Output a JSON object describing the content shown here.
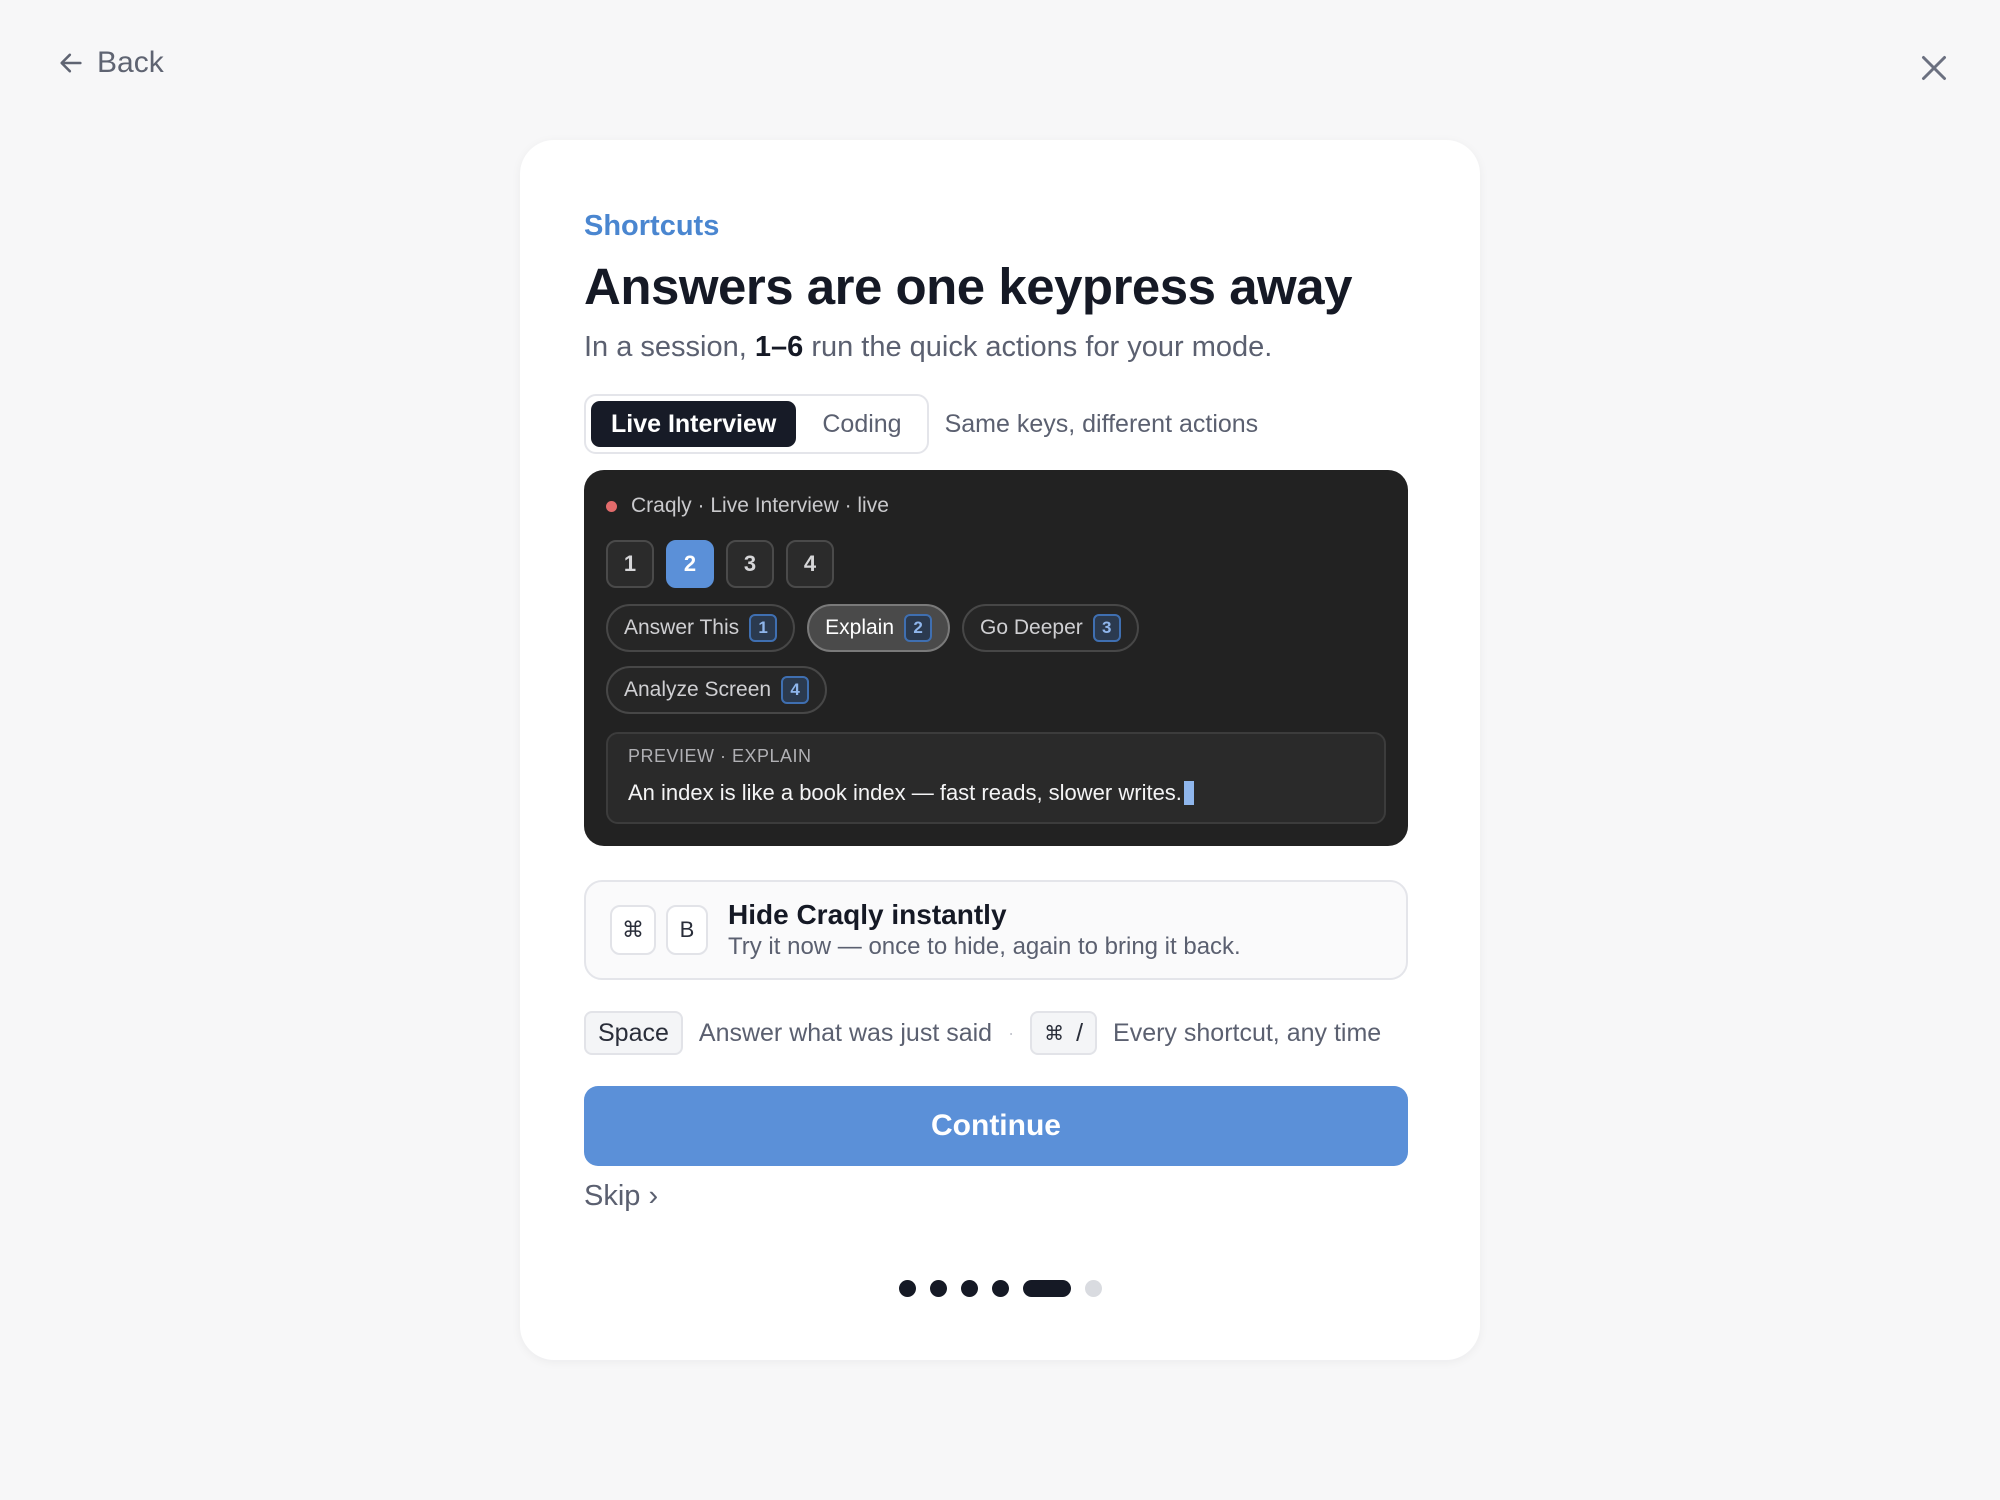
{
  "nav": {
    "back_label": "Back",
    "icons": {
      "back": "arrow-left-icon",
      "close": "close-icon"
    }
  },
  "header": {
    "eyebrow": "Shortcuts",
    "title": "Answers are one keypress away",
    "subtitle_prefix": "In a session, ",
    "subtitle_bold": "1–6",
    "subtitle_suffix": " run the quick actions for your mode."
  },
  "modes": {
    "tabs": [
      {
        "label": "Live Interview",
        "active": true
      },
      {
        "label": "Coding",
        "active": false
      }
    ],
    "hint": "Same keys, different actions"
  },
  "preview": {
    "status": "Craqly · Live Interview · live",
    "keys": [
      "1",
      "2",
      "3",
      "4"
    ],
    "active_key": "2",
    "actions": [
      {
        "label": "Answer This",
        "key": "1"
      },
      {
        "label": "Explain",
        "key": "2"
      },
      {
        "label": "Go Deeper",
        "key": "3"
      },
      {
        "label": "Analyze Screen",
        "key": "4"
      }
    ],
    "box_label": "PREVIEW · EXPLAIN",
    "box_text": "An index is like a book index — fast reads, slower writes."
  },
  "hide": {
    "key_cmd": "⌘",
    "key_b": "B",
    "title": "Hide Craqly instantly",
    "subtitle": "Try it now — once to hide, again to bring it back."
  },
  "shortcuts": {
    "space_key": "Space",
    "space_text": "Answer what was just said",
    "separator": "·",
    "slash_cmd": "⌘",
    "slash_key": "/",
    "slash_text": "Every shortcut, any time"
  },
  "actions": {
    "continue_label": "Continue",
    "skip_label": "Skip ›"
  },
  "pager": {
    "total": 6,
    "current": 5
  },
  "colors": {
    "accent": "#5b90d8",
    "eyebrow": "#4a86d0",
    "dark": "#171b27",
    "live_dot": "#e26b6b"
  }
}
